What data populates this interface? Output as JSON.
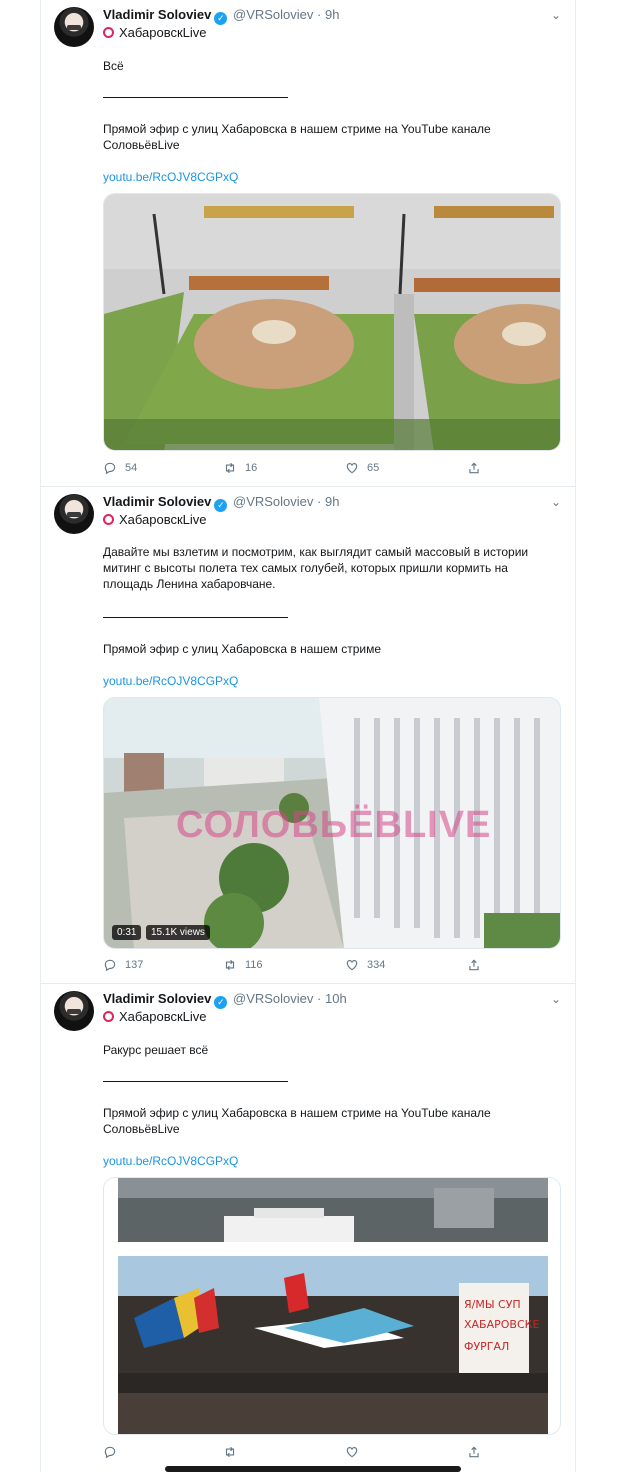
{
  "tweets": [
    {
      "name": "Vladimir Soloviev",
      "handle": "@VRSoloviev",
      "time": "9h",
      "subtitle": "ХабаровскLive",
      "text_lines": [
        "Всё"
      ],
      "separator": "____________________________",
      "promo": "Прямой эфир с улиц Хабаровска в нашем стриме на YouTube канале СоловьёвLive",
      "link": "youtu.be/RcOJV8CGPxQ",
      "replies": "54",
      "retweets": "16",
      "likes": "65"
    },
    {
      "name": "Vladimir Soloviev",
      "handle": "@VRSoloviev",
      "time": "9h",
      "subtitle": "ХабаровскLive",
      "text": "Давайте мы взлетим и посмотрим, как выглядит самый массовый в истории митинг с высоты полета тех самых голубей, которых пришли кормить на площадь Ленина хабаровчане.",
      "separator": "____________________________",
      "promo": "Прямой эфир с улиц Хабаровска в нашем стриме",
      "link": "youtu.be/RcOJV8CGPxQ",
      "watermark": "СОЛОВЬЁВLIVE",
      "duration": "0:31",
      "views": "15.1K views",
      "replies": "137",
      "retweets": "116",
      "likes": "334"
    },
    {
      "name": "Vladimir Soloviev",
      "handle": "@VRSoloviev",
      "time": "10h",
      "subtitle": "ХабаровскLive",
      "text": "Ракурс решает всё",
      "separator": "____________________________",
      "promo": "Прямой эфир с улиц Хабаровска в нашем стриме на YouTube канале СоловьёвLive",
      "link": "youtu.be/RcOJV8CGPxQ",
      "banner": "Я/МЫ СУП ХАБАРОВСКЕ ФУРГАЛ",
      "replies": "",
      "retweets": "",
      "likes": ""
    }
  ],
  "icons": {
    "reply": "reply-icon",
    "retweet": "retweet-icon",
    "like": "heart-icon",
    "share": "share-icon",
    "more": "chevron-down-icon",
    "verified": "verified-badge-icon",
    "live": "live-ring-icon"
  },
  "colors": {
    "link": "#1b95e0",
    "verified": "#1da1f2",
    "live_ring": "#e0245e",
    "muted": "#657786"
  }
}
